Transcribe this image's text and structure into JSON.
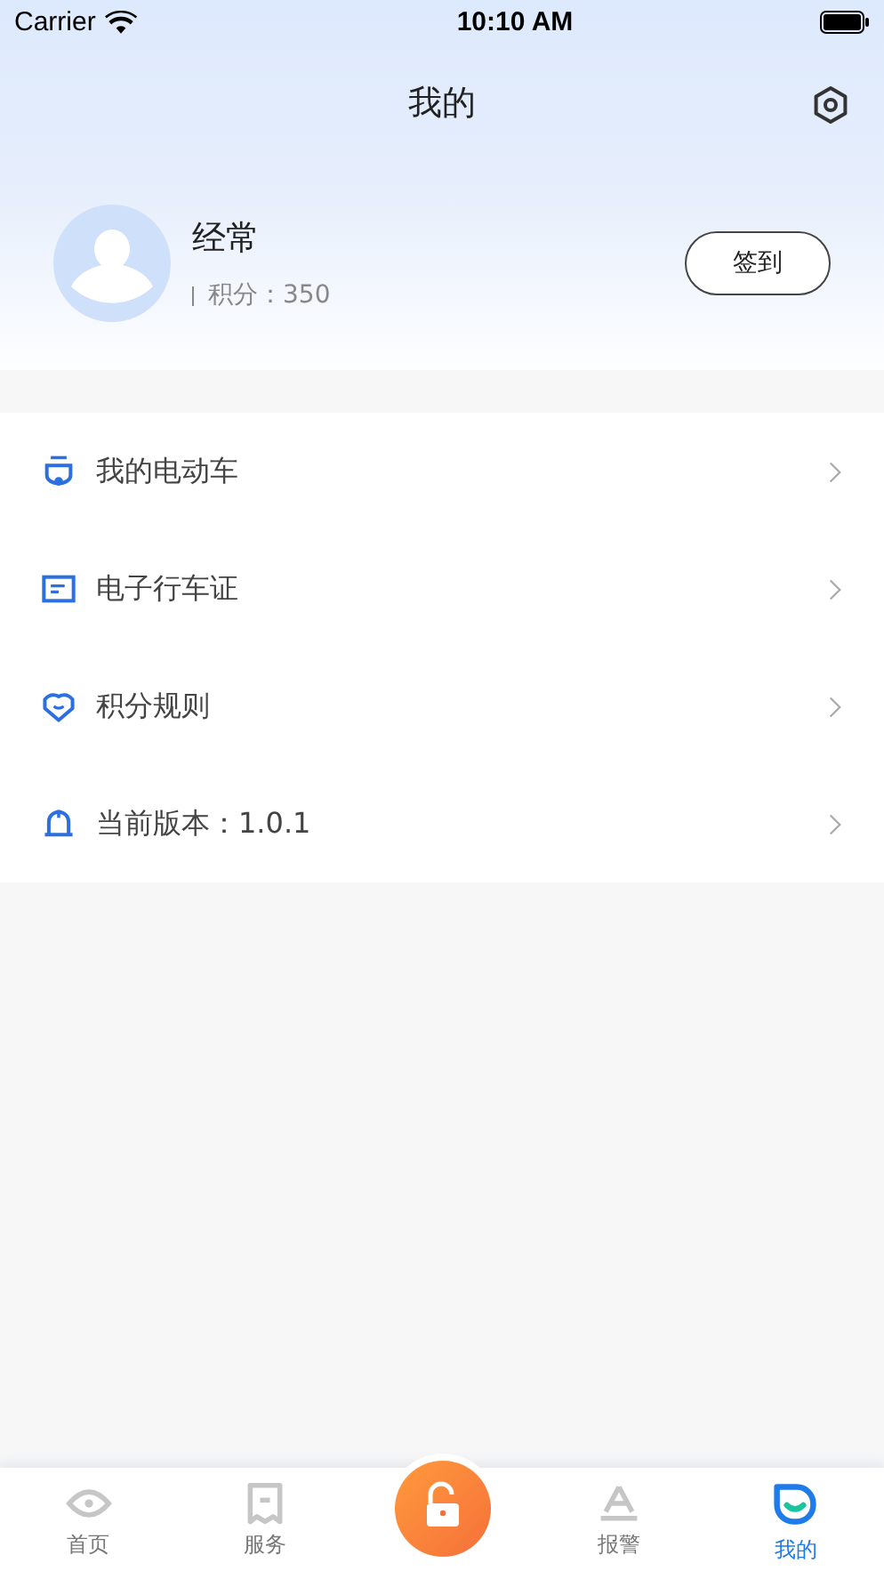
{
  "status_bar": {
    "carrier": "Carrier",
    "time": "10:10 AM"
  },
  "nav": {
    "title": "我的"
  },
  "profile": {
    "name": "经常",
    "points": "积分：350",
    "checkin": "签到"
  },
  "menu": [
    {
      "kind": "scooter",
      "label": "我的电动车"
    },
    {
      "kind": "card",
      "label": "电子行车证"
    },
    {
      "kind": "heart",
      "label": "积分规则"
    },
    {
      "kind": "bell",
      "label": "当前版本：1.0.1"
    }
  ],
  "tabs": [
    {
      "kind": "eye",
      "label": "首页",
      "selected": false
    },
    {
      "kind": "receipt",
      "label": "服务",
      "selected": false
    },
    {
      "kind": "unlock",
      "selected": false
    },
    {
      "kind": "alarm",
      "label": "报警",
      "selected": false
    },
    {
      "kind": "me",
      "label": "我的",
      "selected": true
    }
  ]
}
